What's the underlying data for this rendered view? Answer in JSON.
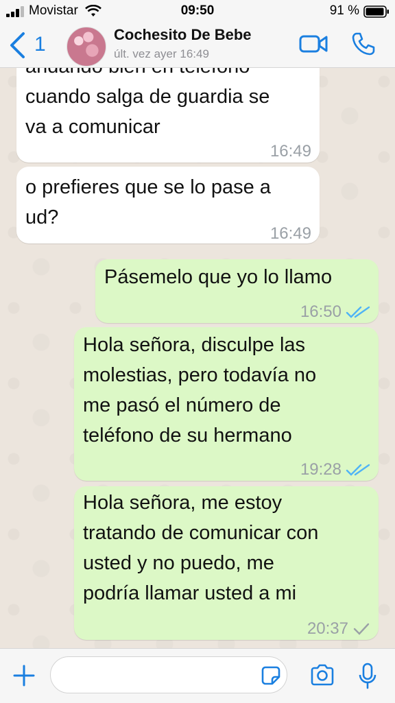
{
  "status": {
    "carrier": "Movistar",
    "time": "09:50",
    "battery": "91 %"
  },
  "header": {
    "back_count": "1",
    "contact_name": "Cochesito De Bebe",
    "last_seen": "últ. vez ayer 16:49",
    "icons": [
      "back-chevron-icon",
      "video-call-icon",
      "phone-call-icon"
    ]
  },
  "messages": [
    {
      "direction": "incoming",
      "text": "andando bien en teléfono\ncuando salga de guardia se\nva a comunicar",
      "time": "16:49"
    },
    {
      "direction": "incoming",
      "text": "o prefieres que se lo pase a\nud?",
      "time": "16:49"
    },
    {
      "direction": "outgoing",
      "text": "Pásemelo que yo lo llamo",
      "time": "16:50",
      "status": "read"
    },
    {
      "direction": "outgoing",
      "text": "Hola señora, disculpe las\nmolestias, pero todavía no\nme pasó el número de\nteléfono de su hermano",
      "time": "19:28",
      "status": "read"
    },
    {
      "direction": "outgoing",
      "text": "Hola señora, me estoy\ntratando de comunicar con\nusted y no puedo, me\npodría llamar usted a mi",
      "time": "20:37",
      "status": "delivered"
    }
  ],
  "footer": {
    "input_value": "",
    "icons": [
      "plus-icon",
      "sticker-icon",
      "camera-icon",
      "microphone-icon"
    ]
  },
  "colors": {
    "accent": "#1a7fe0",
    "outgoing_bubble": "#dcf8c6",
    "incoming_bubble": "#ffffff",
    "read_tick": "#4fb3f6",
    "chat_bg": "#ece5dd"
  }
}
